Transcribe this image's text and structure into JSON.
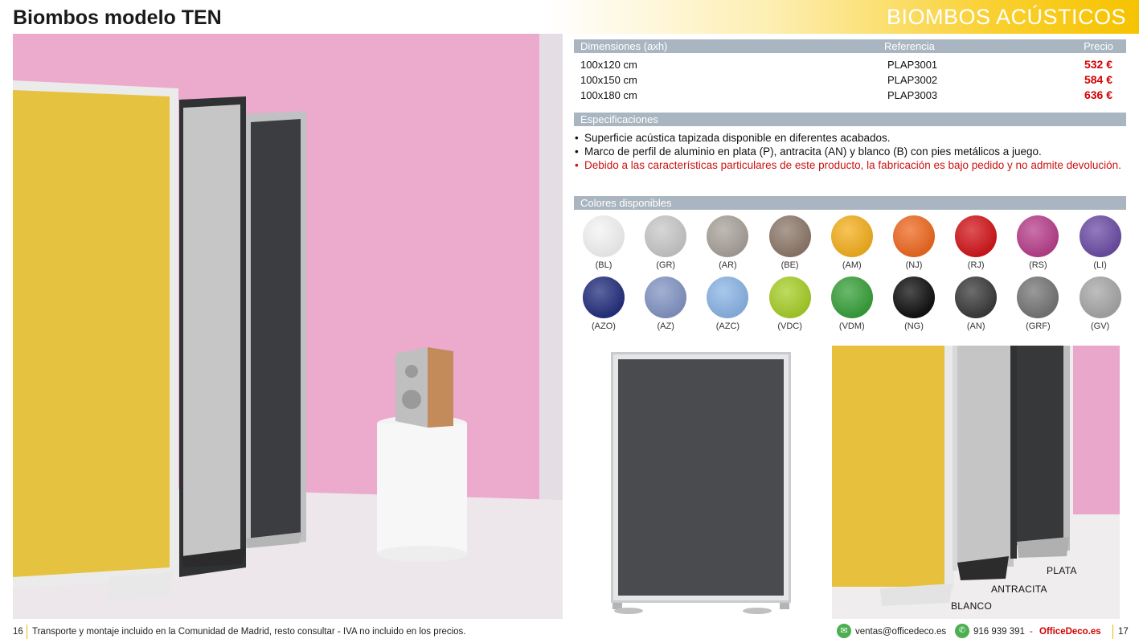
{
  "header": {
    "title": "Biombos modelo TEN",
    "section": "BIOMBOS ACÚSTICOS"
  },
  "table": {
    "columns": [
      "Dimensiones (axh)",
      "Referencia",
      "Precio"
    ],
    "rows": [
      {
        "size": "100x120 cm",
        "ref": "PLAP3001",
        "price": "532 €"
      },
      {
        "size": "100x150 cm",
        "ref": "PLAP3002",
        "price": "584 €"
      },
      {
        "size": "100x180 cm",
        "ref": "PLAP3003",
        "price": "636 €"
      }
    ]
  },
  "specs": {
    "heading": "Especificaciones",
    "items": [
      "Superficie acústica tapizada disponible en diferentes acabados.",
      "Marco de perfil de aluminio en plata (P), antracita (AN) y blanco (B) con pies metálicos a juego.",
      "Debido a las características particulares de este producto, la fabricación es bajo pedido y no admite devolución."
    ]
  },
  "colors": {
    "heading": "Colores disponibles",
    "swatches": [
      {
        "code": "(BL)",
        "hex": "#f4f4f4"
      },
      {
        "code": "(GR)",
        "hex": "#c9c9c9"
      },
      {
        "code": "(AR)",
        "hex": "#aaa39c"
      },
      {
        "code": "(BE)",
        "hex": "#8f7a6c"
      },
      {
        "code": "(AM)",
        "hex": "#f4b020"
      },
      {
        "code": "(NJ)",
        "hex": "#ee6a22"
      },
      {
        "code": "(RJ)",
        "hex": "#d2181d"
      },
      {
        "code": "(RS)",
        "hex": "#b8418c"
      },
      {
        "code": "(LI)",
        "hex": "#6e4fa6"
      },
      {
        "code": "(AZO)",
        "hex": "#26317e"
      },
      {
        "code": "(AZ)",
        "hex": "#8496c4"
      },
      {
        "code": "(AZC)",
        "hex": "#8cb5e6"
      },
      {
        "code": "(VDC)",
        "hex": "#a8cf2b"
      },
      {
        "code": "(VDM)",
        "hex": "#3aa13c"
      },
      {
        "code": "(NG)",
        "hex": "#121212"
      },
      {
        "code": "(AN)",
        "hex": "#3c3c3c"
      },
      {
        "code": "(GRF)",
        "hex": "#777777"
      },
      {
        "code": "(GV)",
        "hex": "#a8a8a8"
      }
    ]
  },
  "frames": {
    "plata": "PLATA",
    "antracita": "ANTRACITA",
    "blanco": "BLANCO"
  },
  "footer": {
    "page_left": "16",
    "note": "Transporte y montaje incluido en la Comunidad de Madrid, resto consultar - IVA no incluido en los precios.",
    "email": "ventas@officedeco.es",
    "phone": "916 939 391",
    "dash": "-",
    "brand": "OfficeDeco.es",
    "page_right": "17",
    "email_icon": "envelope-icon",
    "phone_icon": "whatsapp-icon"
  },
  "theme": {
    "accent": "#f6c300",
    "price_red": "#d40000",
    "bar_gray": "#a9b6c1"
  }
}
